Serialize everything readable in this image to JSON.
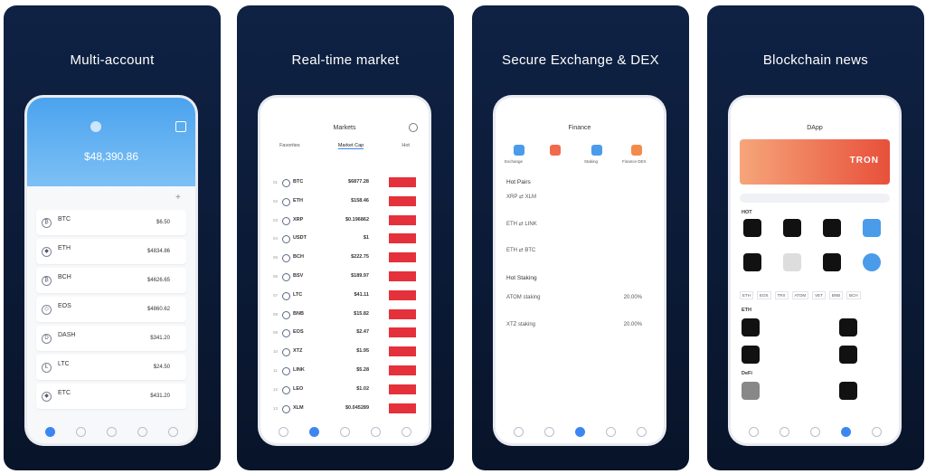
{
  "panels": [
    {
      "title": "Multi-account"
    },
    {
      "title": "Real-time market"
    },
    {
      "title": "Secure Exchange & DEX"
    },
    {
      "title": "Blockchain news"
    }
  ],
  "wallet": {
    "balance": "$48,390.86",
    "coins": [
      {
        "name": "BTC",
        "value": "$6.50"
      },
      {
        "name": "ETH",
        "value": "$4834.86"
      },
      {
        "name": "BCH",
        "value": "$4626.65"
      },
      {
        "name": "EOS",
        "value": "$4860.62"
      },
      {
        "name": "DASH",
        "value": "$341.20"
      },
      {
        "name": "LTC",
        "value": "$24.50"
      },
      {
        "name": "ETC",
        "value": "$431.20"
      }
    ]
  },
  "market": {
    "title": "Markets",
    "tabs": [
      "Favorites",
      "Market Cap",
      "Hot"
    ],
    "rows": [
      {
        "rank": "01",
        "sym": "BTC",
        "price": "$6877.28"
      },
      {
        "rank": "02",
        "sym": "ETH",
        "price": "$158.46"
      },
      {
        "rank": "03",
        "sym": "XRP",
        "price": "$0.196862"
      },
      {
        "rank": "04",
        "sym": "USDT",
        "price": "$1"
      },
      {
        "rank": "05",
        "sym": "BCH",
        "price": "$222.75"
      },
      {
        "rank": "06",
        "sym": "BSV",
        "price": "$189.97"
      },
      {
        "rank": "07",
        "sym": "LTC",
        "price": "$41.11"
      },
      {
        "rank": "08",
        "sym": "BNB",
        "price": "$15.82"
      },
      {
        "rank": "09",
        "sym": "EOS",
        "price": "$2.47"
      },
      {
        "rank": "10",
        "sym": "XTZ",
        "price": "$1.95"
      },
      {
        "rank": "11",
        "sym": "LINK",
        "price": "$5.28"
      },
      {
        "rank": "12",
        "sym": "LEO",
        "price": "$1.02"
      },
      {
        "rank": "13",
        "sym": "XLM",
        "price": "$0.045289"
      }
    ]
  },
  "finance": {
    "title": "Finance",
    "shortcuts": [
      "Exchange",
      "Staking",
      "Finance DEX"
    ],
    "hot_pairs_label": "Hot Pairs",
    "pairs": [
      {
        "left": "XRP",
        "right": "XLM"
      },
      {
        "left": "ETH",
        "right": "LINK"
      },
      {
        "left": "ETH",
        "right": "BTC"
      }
    ],
    "hot_staking_label": "Hot Staking",
    "staking": [
      {
        "name": "ATOM staking",
        "rate": "20.00%"
      },
      {
        "name": "XTZ staking",
        "rate": "20.00%"
      }
    ]
  },
  "dapp": {
    "title": "DApp",
    "banner_text": "TRON",
    "hot_label": "HOT",
    "eth_label": "ETH",
    "defi_label": "DeFi",
    "tags": [
      "ETH",
      "EOS",
      "TRX",
      "ATOM",
      "VET",
      "BNB",
      "BCH"
    ]
  },
  "colors": {
    "bg": "#0b1a36",
    "accent": "#3d86f2",
    "down": "#e4313b"
  }
}
